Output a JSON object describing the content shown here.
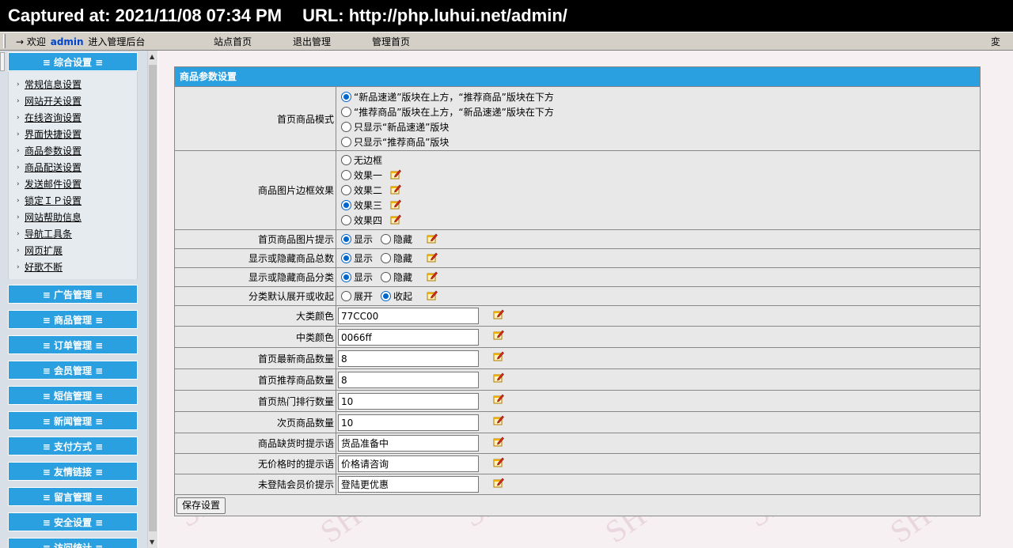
{
  "banner": {
    "captured": "Captured at: 2021/11/08 07:34 PM",
    "url": "URL: http://php.luhui.net/admin/"
  },
  "topbar": {
    "arrow": "→",
    "welcome_prefix": "欢迎",
    "user": "admin",
    "welcome_suffix": "进入管理后台",
    "nav": [
      "站点首页",
      "退出管理",
      "管理首页"
    ],
    "corner": "変"
  },
  "sidebar": {
    "active_section": "≡ 综合设置 ≡",
    "items": [
      "常规信息设置",
      "网站开关设置",
      "在线咨询设置",
      "界面快捷设置",
      "商品参数设置",
      "商品配送设置",
      "发送邮件设置",
      "锁定ＩＰ设置",
      "网站帮助信息",
      "导航工具条",
      "网页扩展",
      "好歌不断"
    ],
    "sections": [
      "≡ 广告管理 ≡",
      "≡ 商品管理 ≡",
      "≡ 订单管理 ≡",
      "≡ 会员管理 ≡",
      "≡ 短信管理 ≡",
      "≡ 新闻管理 ≡",
      "≡ 支付方式 ≡",
      "≡ 友情链接 ≡",
      "≡ 留言管理 ≡",
      "≡ 安全设置 ≡",
      "≡ 访问统计 ≡"
    ]
  },
  "panel": {
    "title": "商品参数设置",
    "mode_label": "首页商品模式",
    "mode_options": [
      "“新品速递”版块在上方，“推荐商品”版块在下方",
      "“推荐商品”版块在上方，“新品速递”版块在下方",
      "只显示“新品速递”版块",
      "只显示“推荐商品”版块"
    ],
    "mode_selected": 0,
    "border_label": "商品图片边框效果",
    "border_options": [
      "无边框",
      "效果一",
      "效果二",
      "效果三",
      "效果四"
    ],
    "border_selected": 3,
    "toggles": [
      {
        "label": "首页商品图片提示",
        "opt1": "显示",
        "opt2": "隐藏",
        "selected": 0
      },
      {
        "label": "显示或隐藏商品总数",
        "opt1": "显示",
        "opt2": "隐藏",
        "selected": 0
      },
      {
        "label": "显示或隐藏商品分类",
        "opt1": "显示",
        "opt2": "隐藏",
        "selected": 0
      },
      {
        "label": "分类默认展开或收起",
        "opt1": "展开",
        "opt2": "收起",
        "selected": 1
      }
    ],
    "fields": [
      {
        "label": "大类颜色",
        "value": "77CC00"
      },
      {
        "label": "中类颜色",
        "value": "0066ff"
      },
      {
        "label": "首页最新商品数量",
        "value": "8"
      },
      {
        "label": "首页推荐商品数量",
        "value": "8"
      },
      {
        "label": "首页热门排行数量",
        "value": "10"
      },
      {
        "label": "次页商品数量",
        "value": "10"
      },
      {
        "label": "商品缺货时提示语",
        "value": "货品准备中"
      },
      {
        "label": "无价格时的提示语",
        "value": "价格请咨询"
      },
      {
        "label": "未登陆会员价提示",
        "value": "登陆更优惠"
      }
    ],
    "save_label": "保存设置"
  },
  "colors": {
    "accent": "#2aa0e0",
    "selected_radio": "#0066cc",
    "banner_bg": "#000000"
  },
  "icons": {
    "edit": "note-edit-icon"
  }
}
